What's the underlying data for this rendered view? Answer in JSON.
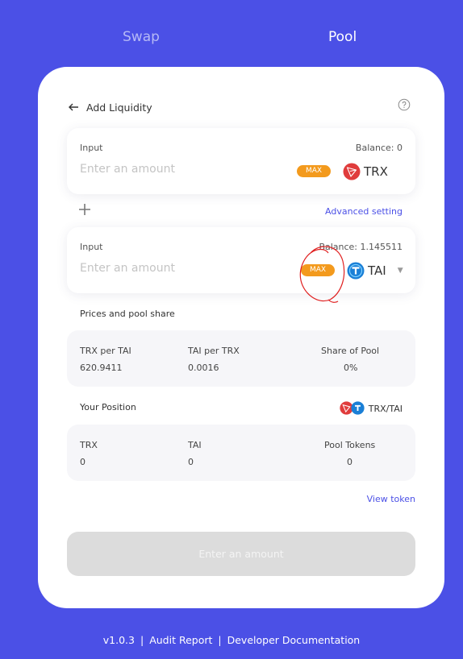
{
  "nav": {
    "swap": "Swap",
    "pool": "Pool"
  },
  "header": {
    "title": "Add Liquidity"
  },
  "input1": {
    "label": "Input",
    "balance": "Balance: 0",
    "placeholder": "Enter an amount",
    "max": "MAX",
    "token": "TRX"
  },
  "add": {
    "advanced": "Advanced setting"
  },
  "input2": {
    "label": "Input",
    "balance": "Balance: 1.145511",
    "placeholder": "Enter an amount",
    "max": "MAX",
    "token": "TAI"
  },
  "prices": {
    "title": "Prices and pool share",
    "col1_label": "TRX per TAI",
    "col1_value": "620.9411",
    "col2_label": "TAI per TRX",
    "col2_value": "0.0016",
    "col3_label": "Share of Pool",
    "col3_value": "0%"
  },
  "position": {
    "title": "Your Position",
    "pair": "TRX/TAI",
    "col1_label": "TRX",
    "col1_value": "0",
    "col2_label": "TAI",
    "col2_value": "0",
    "col3_label": "Pool Tokens",
    "col3_value": "0"
  },
  "view_token": "View token",
  "submit": "Enter an amount",
  "footer": {
    "version": "v1.0.3",
    "sep": "|",
    "audit": "Audit Report",
    "docs": "Developer Documentation"
  },
  "colors": {
    "background": "#4b50e6",
    "accent": "#4b50e6",
    "max": "#f39a1d",
    "trx": "#e03c3c",
    "tai": "#1a7fd6"
  },
  "icons": {
    "back": "arrow-left-icon",
    "help": "question-circle-icon",
    "plus": "plus-icon",
    "trx": "trx-token-icon",
    "tai": "tai-token-icon",
    "caret": "caret-down-icon"
  }
}
